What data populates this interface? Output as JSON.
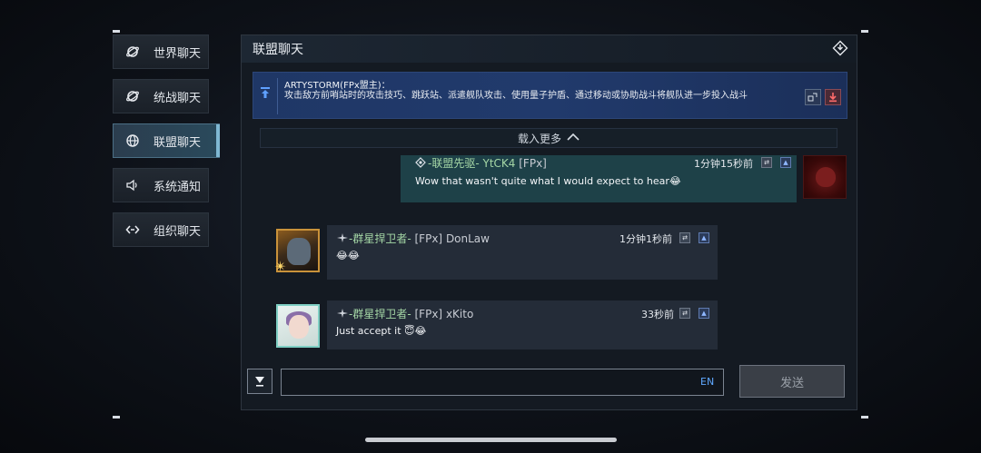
{
  "sidebar": {
    "items": [
      {
        "label": "世界聊天",
        "icon": "planet-icon",
        "active": false
      },
      {
        "label": "统战聊天",
        "icon": "planet-icon",
        "active": false
      },
      {
        "label": "联盟聊天",
        "icon": "globe-icon",
        "active": true
      },
      {
        "label": "系统通知",
        "icon": "speaker-icon",
        "active": false
      },
      {
        "label": "组织聊天",
        "icon": "link-icon",
        "active": false
      }
    ]
  },
  "panel": {
    "title": "联盟聊天",
    "collapse_icon": "collapse-icon"
  },
  "pinned": {
    "author": "ARTYSTORM(FPx盟主)：",
    "text": "攻击敌方前哨站时的攻击技巧、跳跃站、派遣舰队攻击、使用量子护盾、通过移动或协助战斗将舰队进一步投入战斗"
  },
  "load_more": "载入更多",
  "messages": [
    {
      "sender_prefix": "-联盟先驱-",
      "sender_name": "YtCK4",
      "tag": "[FPx]",
      "time": "1分钟15秒前",
      "text": "Wow that wasn't quite what I would expect to hear😂",
      "self": true
    },
    {
      "sender_prefix": "-群星捍卫者-",
      "sender_name": "DonLaw",
      "tag": "[FPx]",
      "time": "1分钟1秒前",
      "text": "😂😂",
      "self": false
    },
    {
      "sender_prefix": "-群星捍卫者-",
      "sender_name": "xKito",
      "tag": "[FPx]",
      "time": "33秒前",
      "text": "Just accept it 😇😂",
      "self": false
    }
  ],
  "input": {
    "value": "",
    "placeholder": "",
    "lang": "EN",
    "send_label": "发送"
  },
  "colors": {
    "pinned_bg": "#213a6c",
    "self_msg_bg": "#1e4148",
    "msg_bg": "#242c38",
    "name_green": "#a5d7a6",
    "accent_blue": "#5fa8ff"
  }
}
